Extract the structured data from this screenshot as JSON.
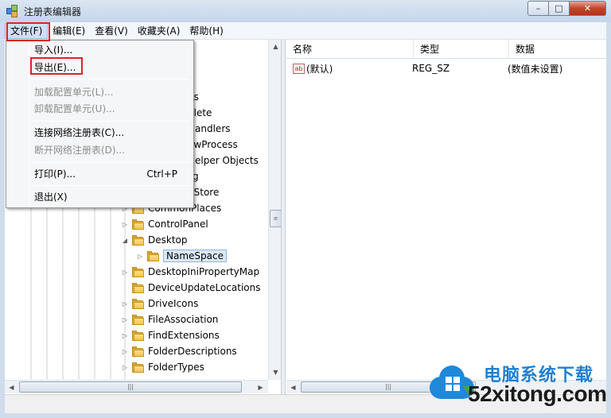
{
  "window": {
    "title": "注册表编辑器"
  },
  "menubar": [
    {
      "label": "文件(F)"
    },
    {
      "label": "编辑(E)"
    },
    {
      "label": "查看(V)"
    },
    {
      "label": "收藏夹(A)"
    },
    {
      "label": "帮助(H)"
    }
  ],
  "file_menu": {
    "import": "导入(I)...",
    "export": "导出(E)...",
    "load_hive": "加载配置单元(L)...",
    "unload_hive": "卸载配置单元(U)...",
    "connect": "连接网络注册表(C)...",
    "disconnect": "断开网络注册表(D)...",
    "print": "打印(P)...",
    "print_accel": "Ctrl+P",
    "exit": "退出(X)"
  },
  "tree": {
    "partial_items": [
      {
        "label": "ns"
      },
      {
        "label": "plete"
      },
      {
        "label": "Handlers"
      },
      {
        "label": "ewProcess"
      },
      {
        "label": "Helper Objects"
      },
      {
        "label": "g"
      },
      {
        "label": "dStore"
      },
      {
        "label": "CommonPlaces"
      }
    ],
    "items": [
      {
        "label": "ControlPanel",
        "expander": "▷"
      },
      {
        "label": "Desktop",
        "expander": "◢"
      },
      {
        "label": "NameSpace",
        "expander": "▷"
      },
      {
        "label": "DesktopIniPropertyMap",
        "expander": "▷"
      },
      {
        "label": "DeviceUpdateLocations",
        "expander": ""
      },
      {
        "label": "DriveIcons",
        "expander": "▷"
      },
      {
        "label": "FileAssociation",
        "expander": "▷"
      },
      {
        "label": "FindExtensions",
        "expander": "▷"
      },
      {
        "label": "FolderDescriptions",
        "expander": "▷"
      },
      {
        "label": "FolderTypes",
        "expander": "▷"
      }
    ],
    "selected": "NameSpace"
  },
  "list": {
    "columns": [
      "名称",
      "类型",
      "数据"
    ],
    "rows": [
      {
        "name": "(默认)",
        "type": "REG_SZ",
        "data": "(数值未设置)",
        "icon": "ab"
      }
    ]
  },
  "scroll_glyphs": {
    "up": "▲",
    "down": "▼",
    "left": "◀",
    "right": "▶",
    "grip": "≡",
    "hgrip": "|||"
  },
  "window_buttons": {
    "minimize": "–",
    "maximize": "□",
    "close": "✕"
  },
  "watermark": {
    "title": "电脑系统下载",
    "url": "52xitong.com"
  }
}
